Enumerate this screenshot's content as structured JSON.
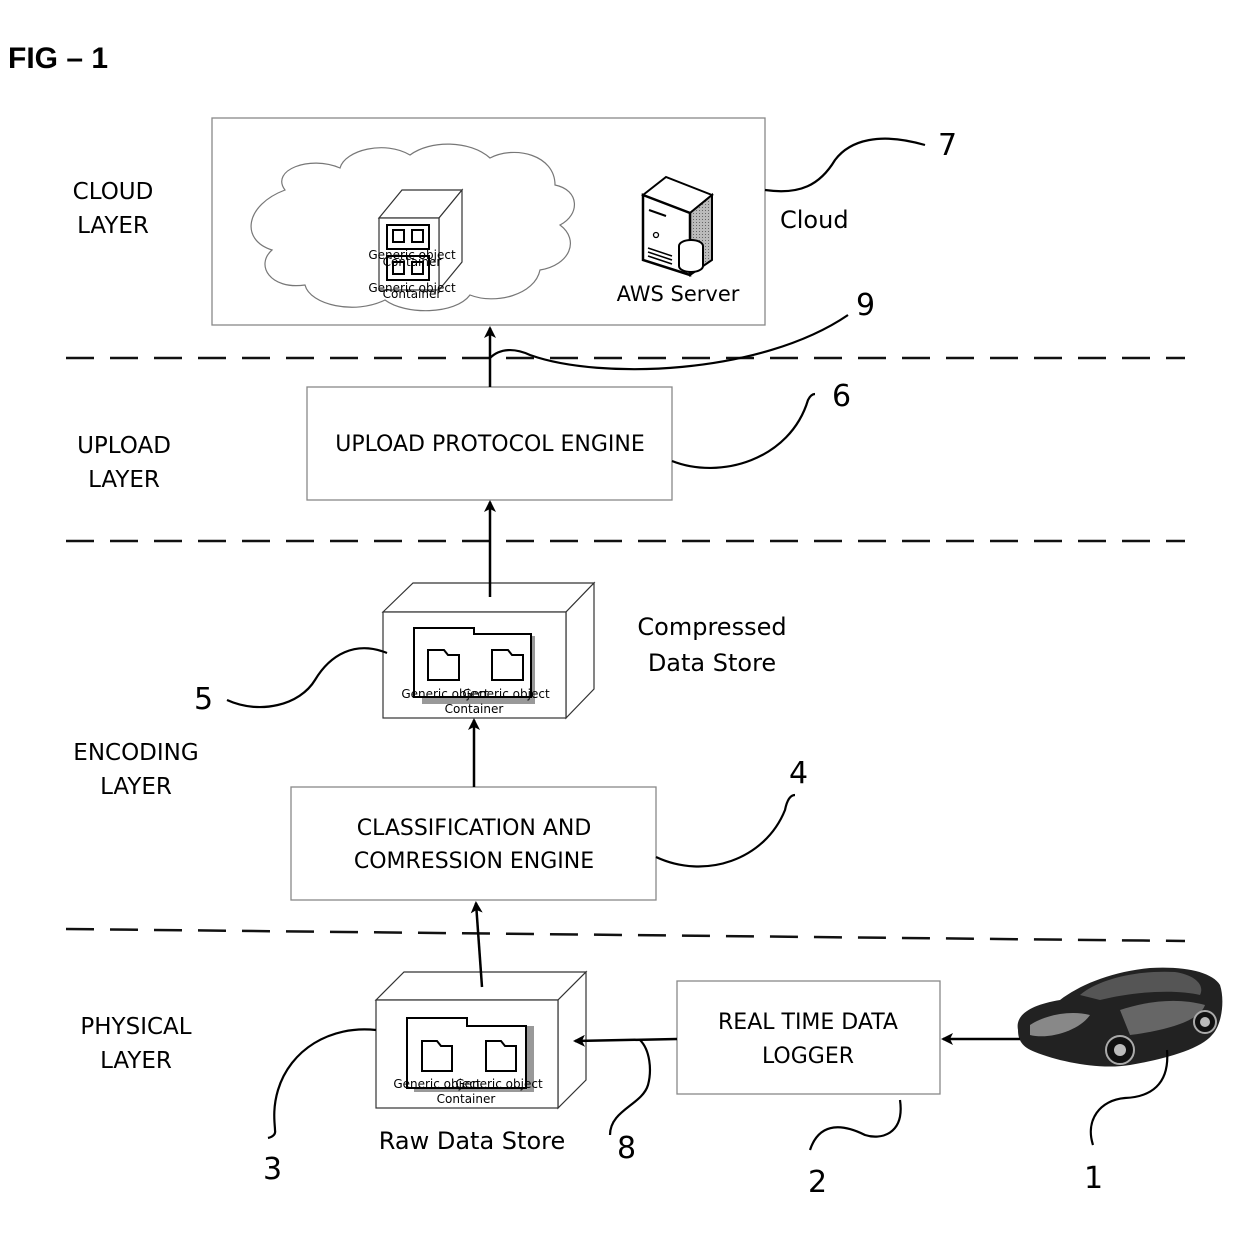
{
  "figure": {
    "title": "FIG – 1"
  },
  "layers": {
    "cloud": [
      "CLOUD",
      "LAYER"
    ],
    "upload": [
      "UPLOAD",
      "LAYER"
    ],
    "encoding": [
      "ENCODING",
      "LAYER"
    ],
    "physical": [
      "PHYSICAL",
      "LAYER"
    ]
  },
  "cloud_box": {
    "label": "Cloud",
    "server_label": "AWS Server",
    "container_text_a": "Generic object",
    "container_text_b": "Container"
  },
  "upload_engine": {
    "label": "UPLOAD PROTOCOL ENGINE"
  },
  "compressed_store": {
    "label_line1": "Compressed",
    "label_line2": "Data Store",
    "object_a": "Generic object",
    "object_b": "Generic object",
    "container": "Container"
  },
  "classification_engine": {
    "line1": "CLASSIFICATION AND",
    "line2": "COMRESSION ENGINE"
  },
  "raw_store": {
    "label": "Raw Data Store",
    "object_a": "Generic object",
    "object_b": "Generic object",
    "container": "Container"
  },
  "data_logger": {
    "line1": "REAL TIME DATA",
    "line2": "LOGGER"
  },
  "vehicle": {
    "icon": "car-icon"
  },
  "reference_numerals": {
    "vehicle": "1",
    "data_logger": "2",
    "raw_store": "3",
    "classification_engine": "4",
    "compressed_store": "5",
    "upload_engine": "6",
    "cloud": "7",
    "logger_link": "8",
    "upload_link": "9"
  }
}
